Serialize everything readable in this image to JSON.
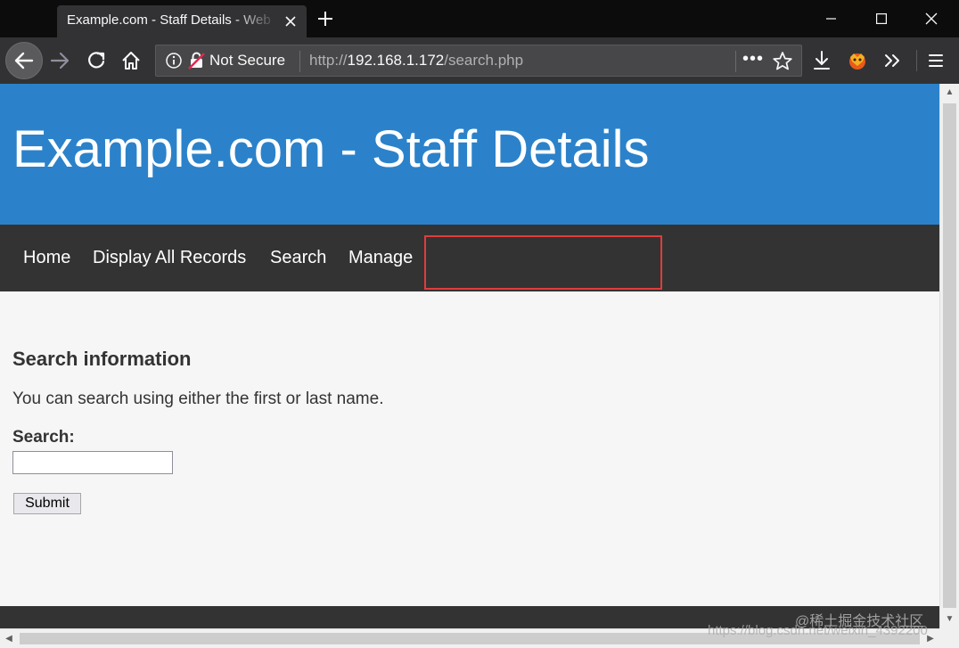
{
  "browser": {
    "tab_title": "Example.com - Staff Details - Web",
    "url_security": "Not Secure",
    "url_prefix": "http://",
    "url_host": "192.168.1.172",
    "url_path": "/search.php",
    "page_actions": "•••"
  },
  "site": {
    "title": "Example.com - Staff Details",
    "nav": [
      {
        "label": "Home"
      },
      {
        "label": "Display All Records"
      },
      {
        "label": "Search"
      },
      {
        "label": "Manage"
      }
    ]
  },
  "main": {
    "heading": "Search information",
    "description": "You can search using either the first or last name.",
    "search_label": "Search:",
    "search_value": "",
    "submit_label": "Submit"
  },
  "watermark": {
    "line1": "@稀土掘金技术社区",
    "line2": "https://blog.csdn.net/weixin_4392200"
  },
  "colors": {
    "header": "#2b82ca",
    "nav": "#333333",
    "highlight": "#e03c3c"
  }
}
